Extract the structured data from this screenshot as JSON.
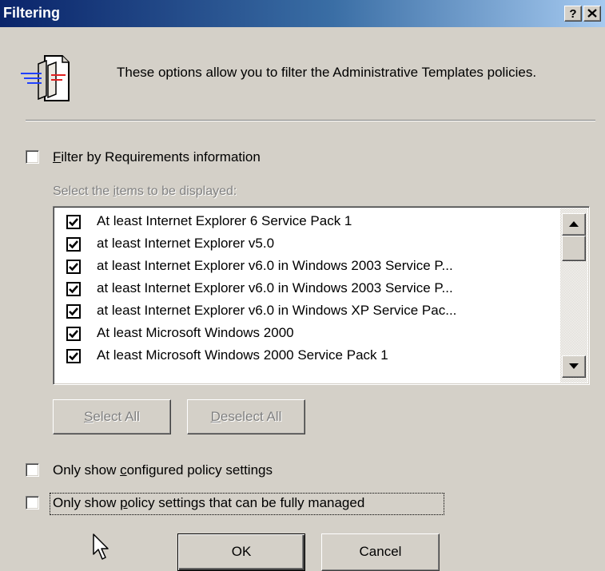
{
  "dialog": {
    "title": "Filtering",
    "help_button": "?",
    "description": "These options allow you to filter the Administrative Templates policies."
  },
  "filter_requirements": {
    "checked": false,
    "label_accel": "F",
    "label_rest": "ilter by Requirements information"
  },
  "items_section": {
    "label_pre": "Select the ",
    "label_accel": "i",
    "label_post": "tems to be displayed:"
  },
  "requirements_list": {
    "items": [
      {
        "label": "At least Internet Explorer 6 Service Pack 1",
        "checked": true
      },
      {
        "label": "at least Internet Explorer v5.0",
        "checked": true
      },
      {
        "label": "at least Internet Explorer v6.0 in Windows 2003 Service P...",
        "checked": true
      },
      {
        "label": "at least Internet Explorer v6.0 in Windows 2003 Service P...",
        "checked": true
      },
      {
        "label": "at least Internet Explorer v6.0 in Windows XP Service Pac...",
        "checked": true
      },
      {
        "label": "At least Microsoft Windows 2000",
        "checked": true
      },
      {
        "label": "At least Microsoft Windows 2000 Service Pack 1",
        "checked": true
      }
    ]
  },
  "select_all": {
    "accel": "S",
    "rest": "elect All"
  },
  "deselect_all": {
    "accel": "D",
    "rest": "eselect All"
  },
  "only_configured": {
    "checked": false,
    "label_pre": "Only show ",
    "label_accel": "c",
    "label_post": "onfigured policy settings"
  },
  "only_managed": {
    "checked": false,
    "label_pre": "Only show ",
    "label_accel": "p",
    "label_post": "olicy settings that can be fully managed"
  },
  "buttons": {
    "ok": "OK",
    "cancel": "Cancel"
  },
  "icons": {
    "header": "filter-policy-icon",
    "close": "close-icon",
    "cursor": "mouse-pointer-icon"
  },
  "colors": {
    "titlebar_start": "#0a246a",
    "titlebar_end": "#a6caf0",
    "face": "#d4d0c8"
  }
}
